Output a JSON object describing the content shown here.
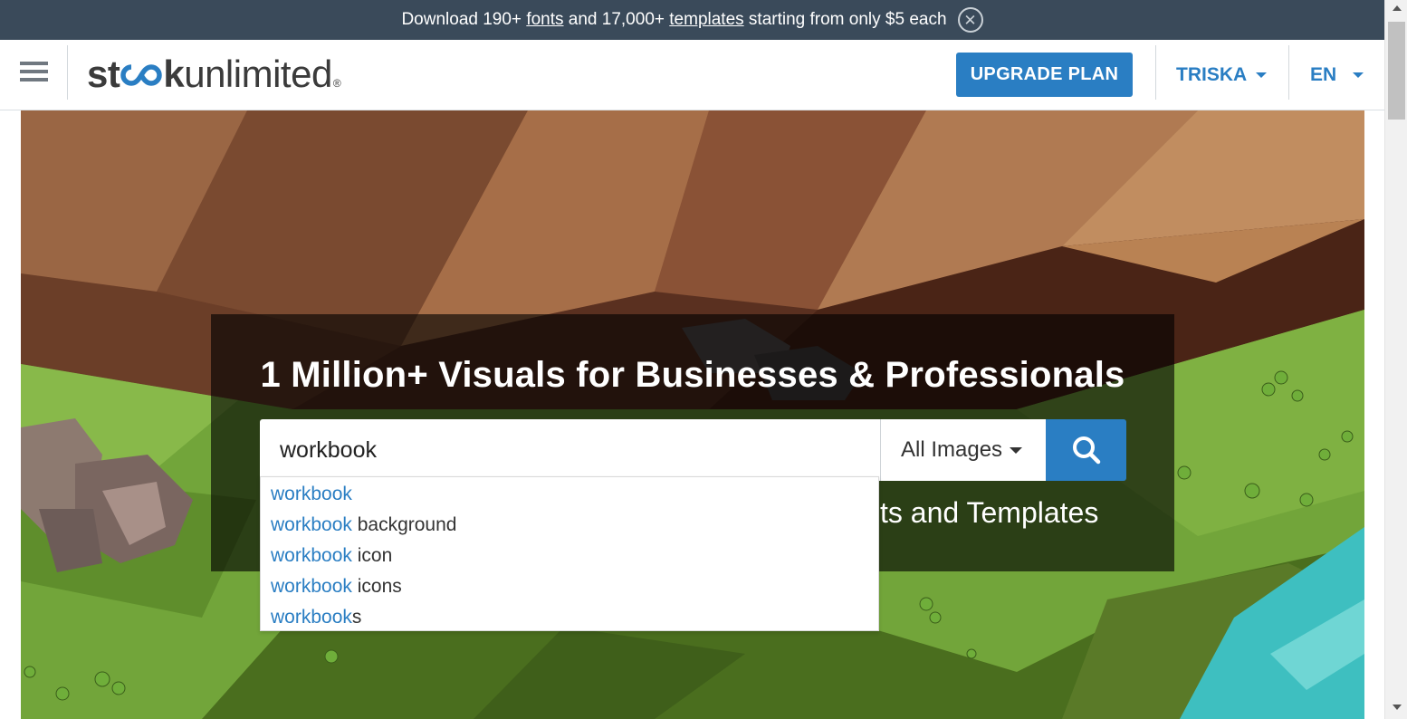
{
  "promo": {
    "text_before": "Download 190+ ",
    "link_fonts": "fonts",
    "text_middle": " and 17,000+ ",
    "link_templates": "templates",
    "text_after": " starting from only $5 each",
    "close_icon": "close-icon"
  },
  "header": {
    "menu_icon": "hamburger-icon",
    "logo": {
      "part1": "st",
      "part2": "k",
      "part3": "unlimited",
      "registered": "®"
    },
    "upgrade_label": "UPGRADE PLAN",
    "user_label": "TRISKA",
    "language_label": "EN"
  },
  "hero": {
    "headline": "1 Million+ Visuals for Businesses & Professionals",
    "subline_visible": "ts and Templates",
    "search": {
      "value": "workbook",
      "type_label": "All Images",
      "search_icon": "search-icon"
    },
    "suggestions": [
      {
        "match": "workbook",
        "rest": ""
      },
      {
        "match": "workbook",
        "rest": " background"
      },
      {
        "match": "workbook",
        "rest": " icon"
      },
      {
        "match": "workbook",
        "rest": " icons"
      },
      {
        "match": "workbook",
        "rest": "s"
      }
    ]
  },
  "colors": {
    "accent": "#2a7ec3",
    "promo_bg": "#3a4a5a"
  }
}
